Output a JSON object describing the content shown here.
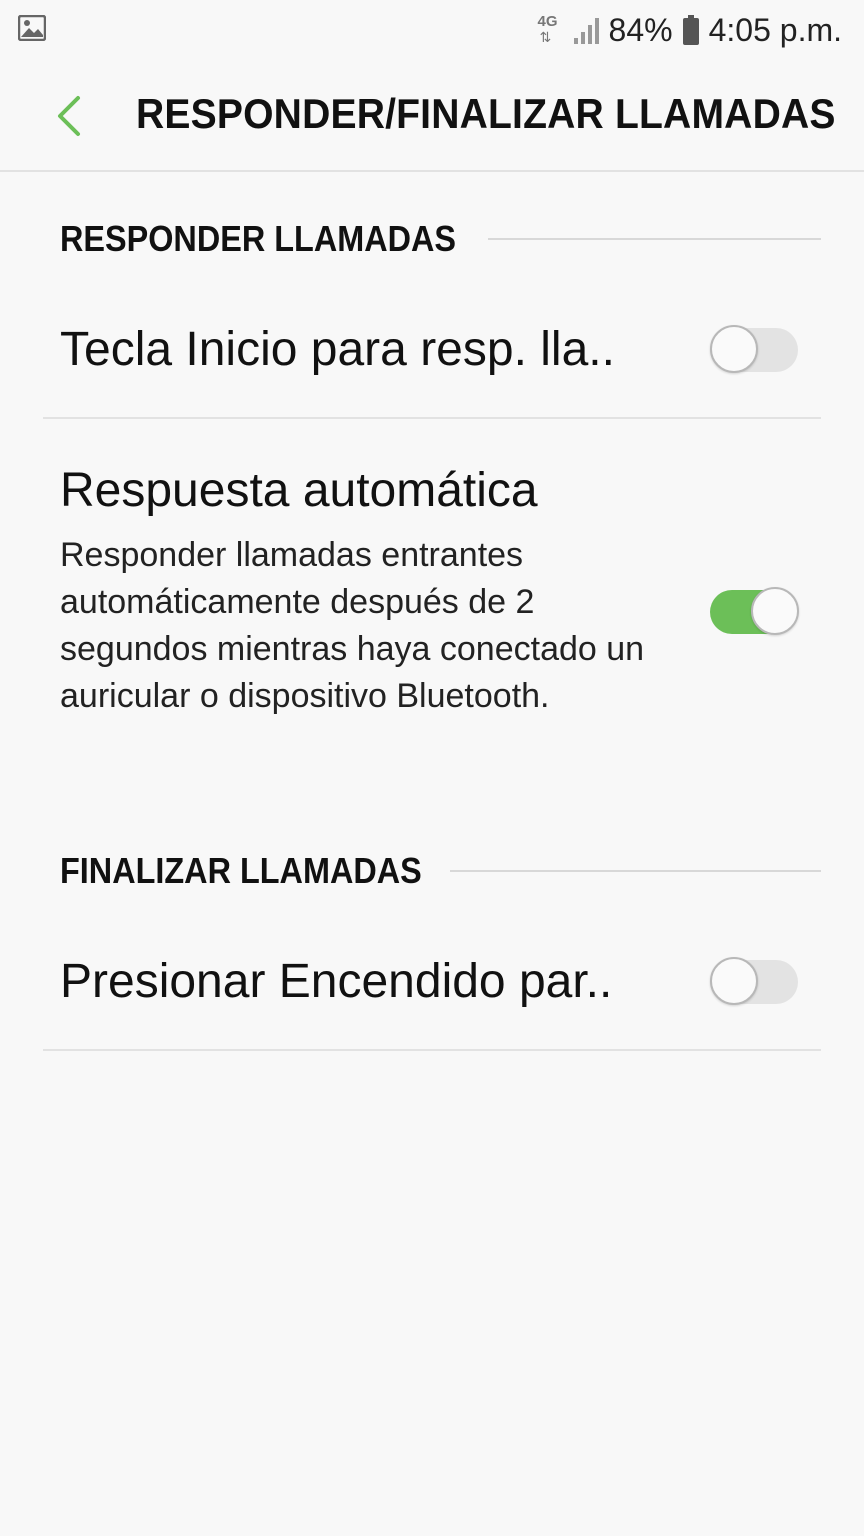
{
  "status_bar": {
    "left_icon": "image-icon",
    "network": "4G",
    "network_arrows": "⇅",
    "battery": "84%",
    "time": "4:05 p.m."
  },
  "header": {
    "back_icon": "chevron-left-icon",
    "title": "RESPONDER/FINALIZAR LLAMADAS"
  },
  "sections": {
    "answer": {
      "title": "RESPONDER LLAMADAS",
      "items": [
        {
          "title": "Tecla Inicio para resp. lla..",
          "enabled": false
        },
        {
          "title": "Respuesta automática",
          "summary": "Responder llamadas entrantes automáticamente después de 2 segundos mientras haya conectado un auricular o dispositivo Bluetooth.",
          "enabled": true
        }
      ]
    },
    "end": {
      "title": "FINALIZAR LLAMADAS",
      "items": [
        {
          "title": "Presionar Encendido par..",
          "enabled": false
        }
      ]
    }
  },
  "colors": {
    "accent": "#6cbf58",
    "background": "#f8f8f8",
    "switch_off_track": "#e3e3e3"
  }
}
